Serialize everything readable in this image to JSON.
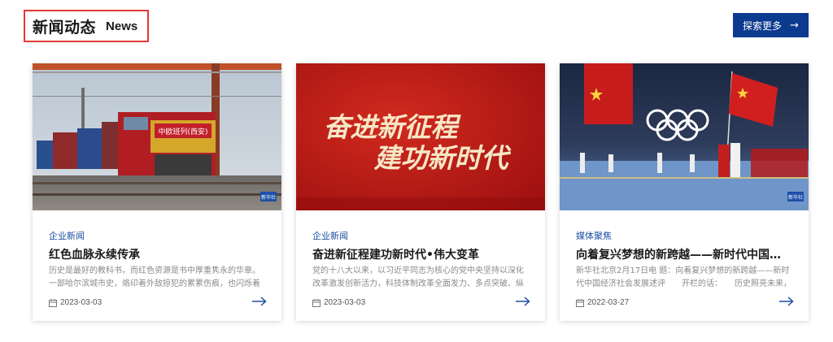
{
  "header": {
    "title": "新闻动态",
    "subtitle": "News"
  },
  "more_button": {
    "label": "探索更多",
    "arrow": "→"
  },
  "cards": [
    {
      "category": "企业新闻",
      "title": "红色血脉永续传承",
      "desc": "历史是最好的教科书，而红色资源是书中厚重隽永的华章。一部哈尔滨城市史，烙印着外敌掠犯的累累伤痕，也闪烁着无数英雄的耀眼光芒。",
      "date": "2023-03-03",
      "image": "freight train at railway station",
      "train_sign": "中欧班列(西安)",
      "image_badge": "新华社"
    },
    {
      "category": "企业新闻",
      "title": "奋进新征程建功新时代•伟大变革",
      "desc": "党的十八大以来，以习近平同志为核心的党中央坚持以深化改革激发创新活力，科技体制改革全面发力、多点突破、纵深发展，涉及范围之",
      "date": "2023-03-03",
      "image": "red banner with slogan",
      "banner_line1": "奋进新征程",
      "banner_line2": "建功新时代"
    },
    {
      "category": "媒体聚焦",
      "title": "向着复兴梦想的新跨越——新时代中国经济社会发展述评",
      "desc": "新华社北京2月17日电 题：向着复兴梦想的新跨越——新时代中国经济社会发展述评　　开栏的话：　　历史照亮未来，奋斗成就伟业。",
      "date": "2022-03-27",
      "image": "olympic opening ceremony with chinese flag",
      "image_badge": "新华社"
    }
  ],
  "colors": {
    "accent": "#0b3a8f",
    "highlight_border": "#e53935",
    "category": "#1b4ea3"
  },
  "icons": {
    "date": "calendar-icon",
    "more": "arrow-right-icon"
  }
}
